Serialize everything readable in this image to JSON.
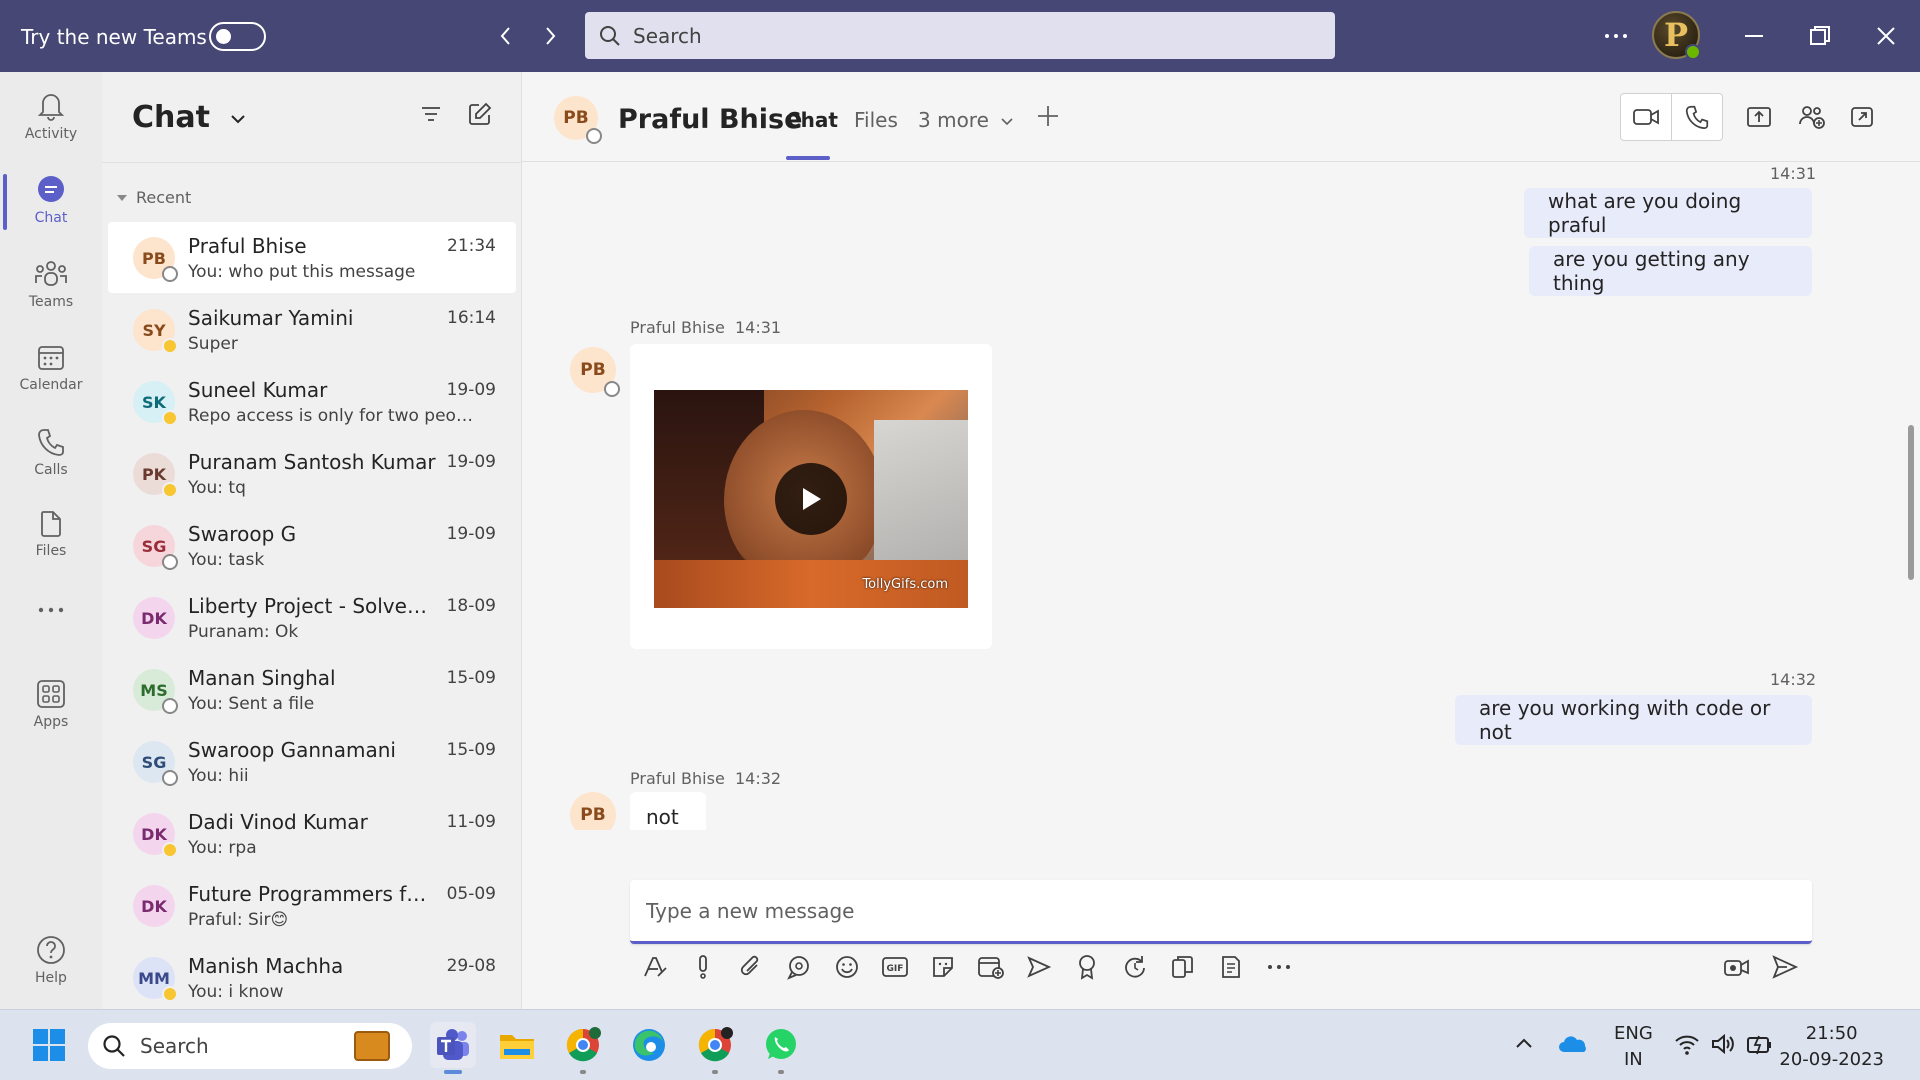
{
  "titlebar": {
    "try_label": "Try the new Teams",
    "search_placeholder": "Search",
    "user_initial": "P"
  },
  "rail": [
    {
      "label": "Activity",
      "icon": "bell-icon"
    },
    {
      "label": "Chat",
      "icon": "chat-icon",
      "active": true
    },
    {
      "label": "Teams",
      "icon": "teams-icon"
    },
    {
      "label": "Calendar",
      "icon": "calendar-icon"
    },
    {
      "label": "Calls",
      "icon": "phone-icon"
    },
    {
      "label": "Files",
      "icon": "file-icon"
    },
    {
      "label": "Apps",
      "icon": "apps-icon"
    },
    {
      "label": "Help",
      "icon": "help-icon"
    }
  ],
  "chat_list": {
    "title": "Chat",
    "section": "Recent",
    "conversations": [
      {
        "initials": "PB",
        "name": "Praful Bhise",
        "preview": "You: who put this message",
        "time": "21:34",
        "color": "#fde4cc",
        "fg": "#8a4b1c",
        "presence": "off",
        "selected": true
      },
      {
        "initials": "SY",
        "name": "Saikumar Yamini",
        "preview": "Super",
        "time": "16:14",
        "color": "#fde4cc",
        "fg": "#8a4b1c",
        "presence": "away"
      },
      {
        "initials": "SK",
        "name": "Suneel Kumar",
        "preview": "Repo access is only for two people...",
        "time": "19-09",
        "color": "#d6f0f5",
        "fg": "#0e6b7a",
        "presence": "away"
      },
      {
        "initials": "PK",
        "name": "Puranam Santosh Kumar",
        "preview": "You: tq",
        "time": "19-09",
        "color": "#ecdcd8",
        "fg": "#6b3a2e",
        "presence": "away"
      },
      {
        "initials": "SG",
        "name": "Swaroop G",
        "preview": "You: task",
        "time": "19-09",
        "color": "#f6d6da",
        "fg": "#9b2c3a",
        "presence": "off"
      },
      {
        "initials": "DK",
        "name": "Liberty Project - Solvente...",
        "preview": "Puranam: Ok",
        "time": "18-09",
        "color": "#f3d6ee",
        "fg": "#7a2a6e",
        "presence": "none"
      },
      {
        "initials": "MS",
        "name": "Manan Singhal",
        "preview": "You: Sent a file",
        "time": "15-09",
        "color": "#d8ebd8",
        "fg": "#2e6b2e",
        "presence": "off"
      },
      {
        "initials": "SG",
        "name": "Swaroop Gannamani",
        "preview": "You: hii",
        "time": "15-09",
        "color": "#dde7f2",
        "fg": "#2e4e7a",
        "presence": "off"
      },
      {
        "initials": "DK",
        "name": "Dadi Vinod Kumar",
        "preview": "You: rpa",
        "time": "11-09",
        "color": "#f3d6ee",
        "fg": "#7a2a6e",
        "presence": "away"
      },
      {
        "initials": "DK",
        "name": "Future Programmers for ...",
        "preview": "Praful: Sir😊",
        "time": "05-09",
        "color": "#f3d6ee",
        "fg": "#7a2a6e",
        "presence": "none"
      },
      {
        "initials": "MM",
        "name": "Manish Machha",
        "preview": "You: i know",
        "time": "29-08",
        "color": "#dde3f7",
        "fg": "#3a4a8a",
        "presence": "away"
      }
    ]
  },
  "header": {
    "initials": "PB",
    "name": "Praful Bhise",
    "tabs": [
      "Chat",
      "Files",
      "3 more"
    ]
  },
  "messages": {
    "t1": "14:31",
    "m1": "what are you doing praful",
    "m2": "are you getting any thing",
    "sender1": "Praful Bhise",
    "sender1_time": "14:31",
    "gif_watermark": "TollyGifs.com",
    "t2": "14:32",
    "m3": "are you working with code or not",
    "sender2": "Praful Bhise",
    "sender2_time": "14:32",
    "m4": "not",
    "avatar_initials": "PB"
  },
  "compose": {
    "placeholder": "Type a new message"
  },
  "taskbar": {
    "search_placeholder": "Search",
    "lang_top": "ENG",
    "lang_bottom": "IN",
    "time": "21:50",
    "date": "20-09-2023"
  }
}
